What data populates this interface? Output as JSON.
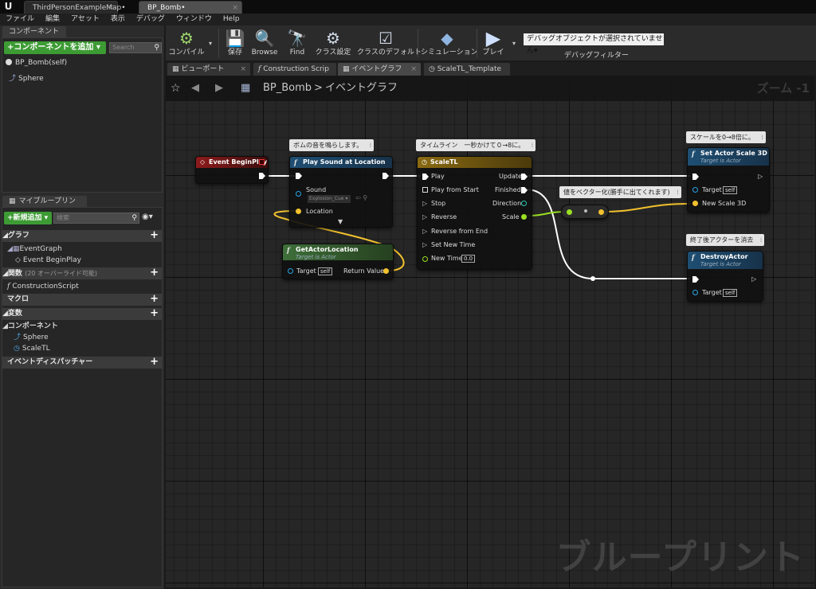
{
  "titlebar": {
    "tabs": [
      {
        "label": "ThirdPersonExampleMap•"
      },
      {
        "label": "BP_Bomb•"
      }
    ]
  },
  "menubar": {
    "items": [
      "ファイル",
      "編集",
      "アセット",
      "表示",
      "デバッグ",
      "ウィンドウ",
      "Help"
    ]
  },
  "components_panel": {
    "tab_label": "コンポーネント",
    "add_button": "+コンポーネントを追加 ▾",
    "search_placeholder": "Search",
    "items": [
      "BP_Bomb(self)",
      "Sphere"
    ]
  },
  "myblueprint_panel": {
    "tab_label": "マイブループリント",
    "new_button": "+新規追加 ▾",
    "search_placeholder": "検索",
    "categories": {
      "graph": {
        "label": "グラフ",
        "items": [
          "EventGraph",
          "Event BeginPlay"
        ]
      },
      "functions": {
        "label": "関数",
        "note": "(20 オーバーライド可能)",
        "items": [
          "ConstructionScript"
        ]
      },
      "macros": {
        "label": "マクロ"
      },
      "variables": {
        "label": "変数"
      },
      "components": {
        "label": "コンポーネント",
        "items": [
          "Sphere",
          "ScaleTL"
        ]
      },
      "dispatchers": {
        "label": "イベントディスパッチャー"
      }
    }
  },
  "toolbar": {
    "buttons": [
      {
        "label": "コンパイル",
        "icon": "compile-gear-icon"
      },
      {
        "label": "保存",
        "icon": "save-icon"
      },
      {
        "label": "Browse",
        "icon": "browse-icon"
      },
      {
        "label": "Find",
        "icon": "find-icon"
      },
      {
        "label": "クラス設定",
        "icon": "class-settings-icon"
      },
      {
        "label": "クラスのデフォルト",
        "icon": "class-defaults-icon"
      },
      {
        "label": "シミュレーション",
        "icon": "simulation-icon"
      },
      {
        "label": "プレイ",
        "icon": "play-icon"
      }
    ],
    "debug_dropdown": "デバッグオブジェクトが選択されていません▾",
    "debug_filter_label": "デバッグフィルター"
  },
  "editor_tabs": [
    {
      "label": "ビューポート",
      "active": false
    },
    {
      "label": "Construction Scrip",
      "active": false
    },
    {
      "label": "イベントグラフ",
      "active": true
    },
    {
      "label": "ScaleTL_Template",
      "active": false
    }
  ],
  "graph": {
    "breadcrumb_root": "BP_Bomb",
    "breadcrumb_sep": ">",
    "breadcrumb_current": "イベントグラフ",
    "zoom": "ズーム -1",
    "watermark": "ブループリント",
    "comments": {
      "sound": "ボムの音を鳴らします。",
      "timeline": "タイムライン　一秒かけて０→8に。",
      "scale": "スケールを0→8倍に。",
      "vector": "値をベクター化(勝手に出てくれます)",
      "destroy": "終了後アクターを消去"
    },
    "nodes": {
      "begin_play": {
        "title": "Event BeginPlay"
      },
      "play_sound": {
        "title": "Play Sound at Location",
        "pin_sound": "Sound",
        "sound_value": "Explosion_Cue ▾",
        "pin_location": "Location"
      },
      "get_actor_location": {
        "title": "GetActorLocation",
        "subtitle": "Target is Actor",
        "pin_target": "Target",
        "target_value": "self",
        "pin_return": "Return Value"
      },
      "scale_tl": {
        "title": "ScaleTL",
        "inputs": [
          "Play",
          "Play from Start",
          "Stop",
          "Reverse",
          "Reverse from End",
          "Set New Time",
          "New Time"
        ],
        "new_time_value": "0.0",
        "outputs": [
          "Update",
          "Finished",
          "Direction",
          "Scale"
        ]
      },
      "set_actor_scale": {
        "title": "Set Actor Scale 3D",
        "subtitle": "Target is Actor",
        "pin_target": "Target",
        "target_value": "self",
        "pin_scale": "New Scale 3D"
      },
      "destroy_actor": {
        "title": "DestroyActor",
        "subtitle": "Target is Actor",
        "pin_target": "Target",
        "target_value": "self"
      }
    }
  },
  "colors": {
    "green_button": "#3d9b34",
    "event_node_header": "#8e1b1b",
    "function_node_header": "#1f4f73",
    "pure_function_header": "#3f6f3a",
    "timeline_header": "#8a6a12",
    "float_wire": "#9be022",
    "vector_wire": "#f2c12e"
  }
}
